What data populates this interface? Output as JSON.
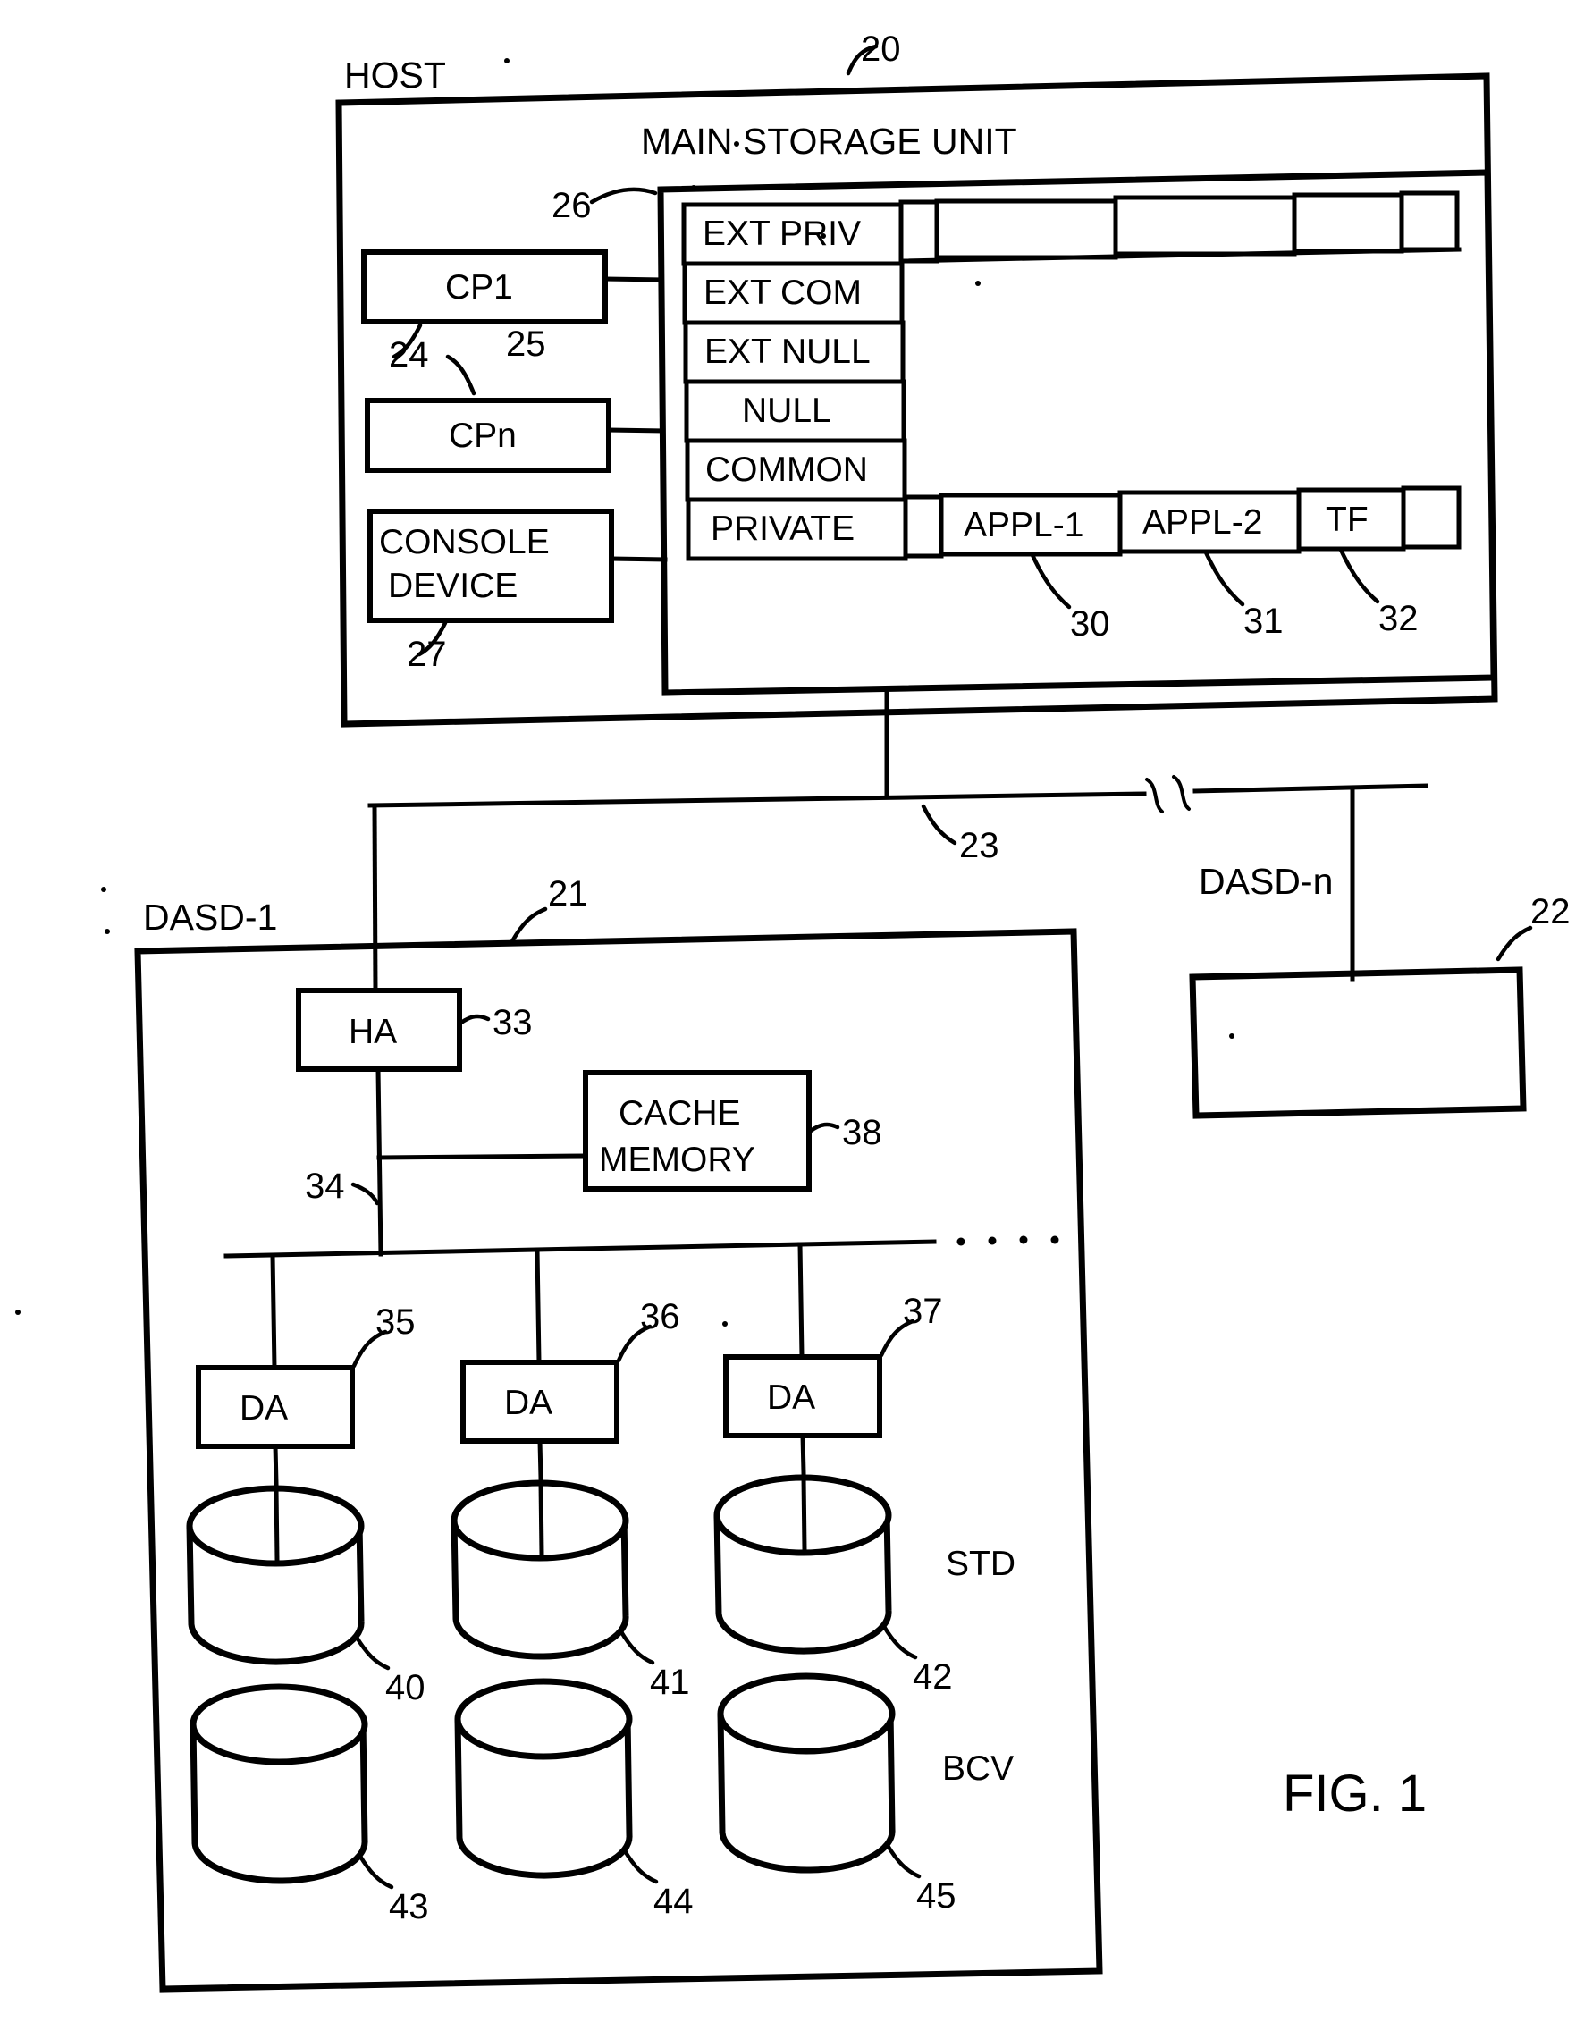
{
  "figure": {
    "caption": "FIG. 1",
    "host": {
      "label": "HOST",
      "ref": "20",
      "main_storage": {
        "title": "MAIN STORAGE UNIT",
        "ref": "26",
        "segments": [
          {
            "label": "EXT PRIV"
          },
          {
            "label": "EXT COM"
          },
          {
            "label": "EXT NULL"
          },
          {
            "label": "NULL"
          },
          {
            "label": "COMMON"
          },
          {
            "label": "PRIVATE"
          }
        ],
        "private_row_cells": [
          {
            "label": "APPL-1",
            "ref": "30"
          },
          {
            "label": "APPL-2",
            "ref": "31"
          },
          {
            "label": "TF",
            "ref": "32"
          }
        ]
      },
      "processors": [
        {
          "label": "CP1",
          "ref": "24"
        },
        {
          "label": "CPn",
          "ref": "25"
        }
      ],
      "console": {
        "label": "CONSOLE DEVICE",
        "line1": "CONSOLE",
        "line2": "DEVICE",
        "ref": "27"
      }
    },
    "bus": {
      "ref": "23"
    },
    "dasd1": {
      "label": "DASD-1",
      "ref": "21",
      "host_adapter": {
        "label": "HA",
        "ref": "33"
      },
      "internal_bus_ref": "34",
      "cache": {
        "line1": "CACHE",
        "line2": "MEMORY",
        "label": "CACHE MEMORY",
        "ref": "38"
      },
      "disk_adapters": [
        {
          "label": "DA",
          "ref": "35"
        },
        {
          "label": "DA",
          "ref": "36"
        },
        {
          "label": "DA",
          "ref": "37"
        }
      ],
      "std_group": {
        "label": "STD",
        "volumes": [
          {
            "ref": "40"
          },
          {
            "ref": "41"
          },
          {
            "ref": "42"
          }
        ]
      },
      "bcv_group": {
        "label": "BCV",
        "volumes": [
          {
            "ref": "43"
          },
          {
            "ref": "44"
          },
          {
            "ref": "45"
          }
        ]
      }
    },
    "dasdn": {
      "label": "DASD-n",
      "ref": "22"
    }
  }
}
